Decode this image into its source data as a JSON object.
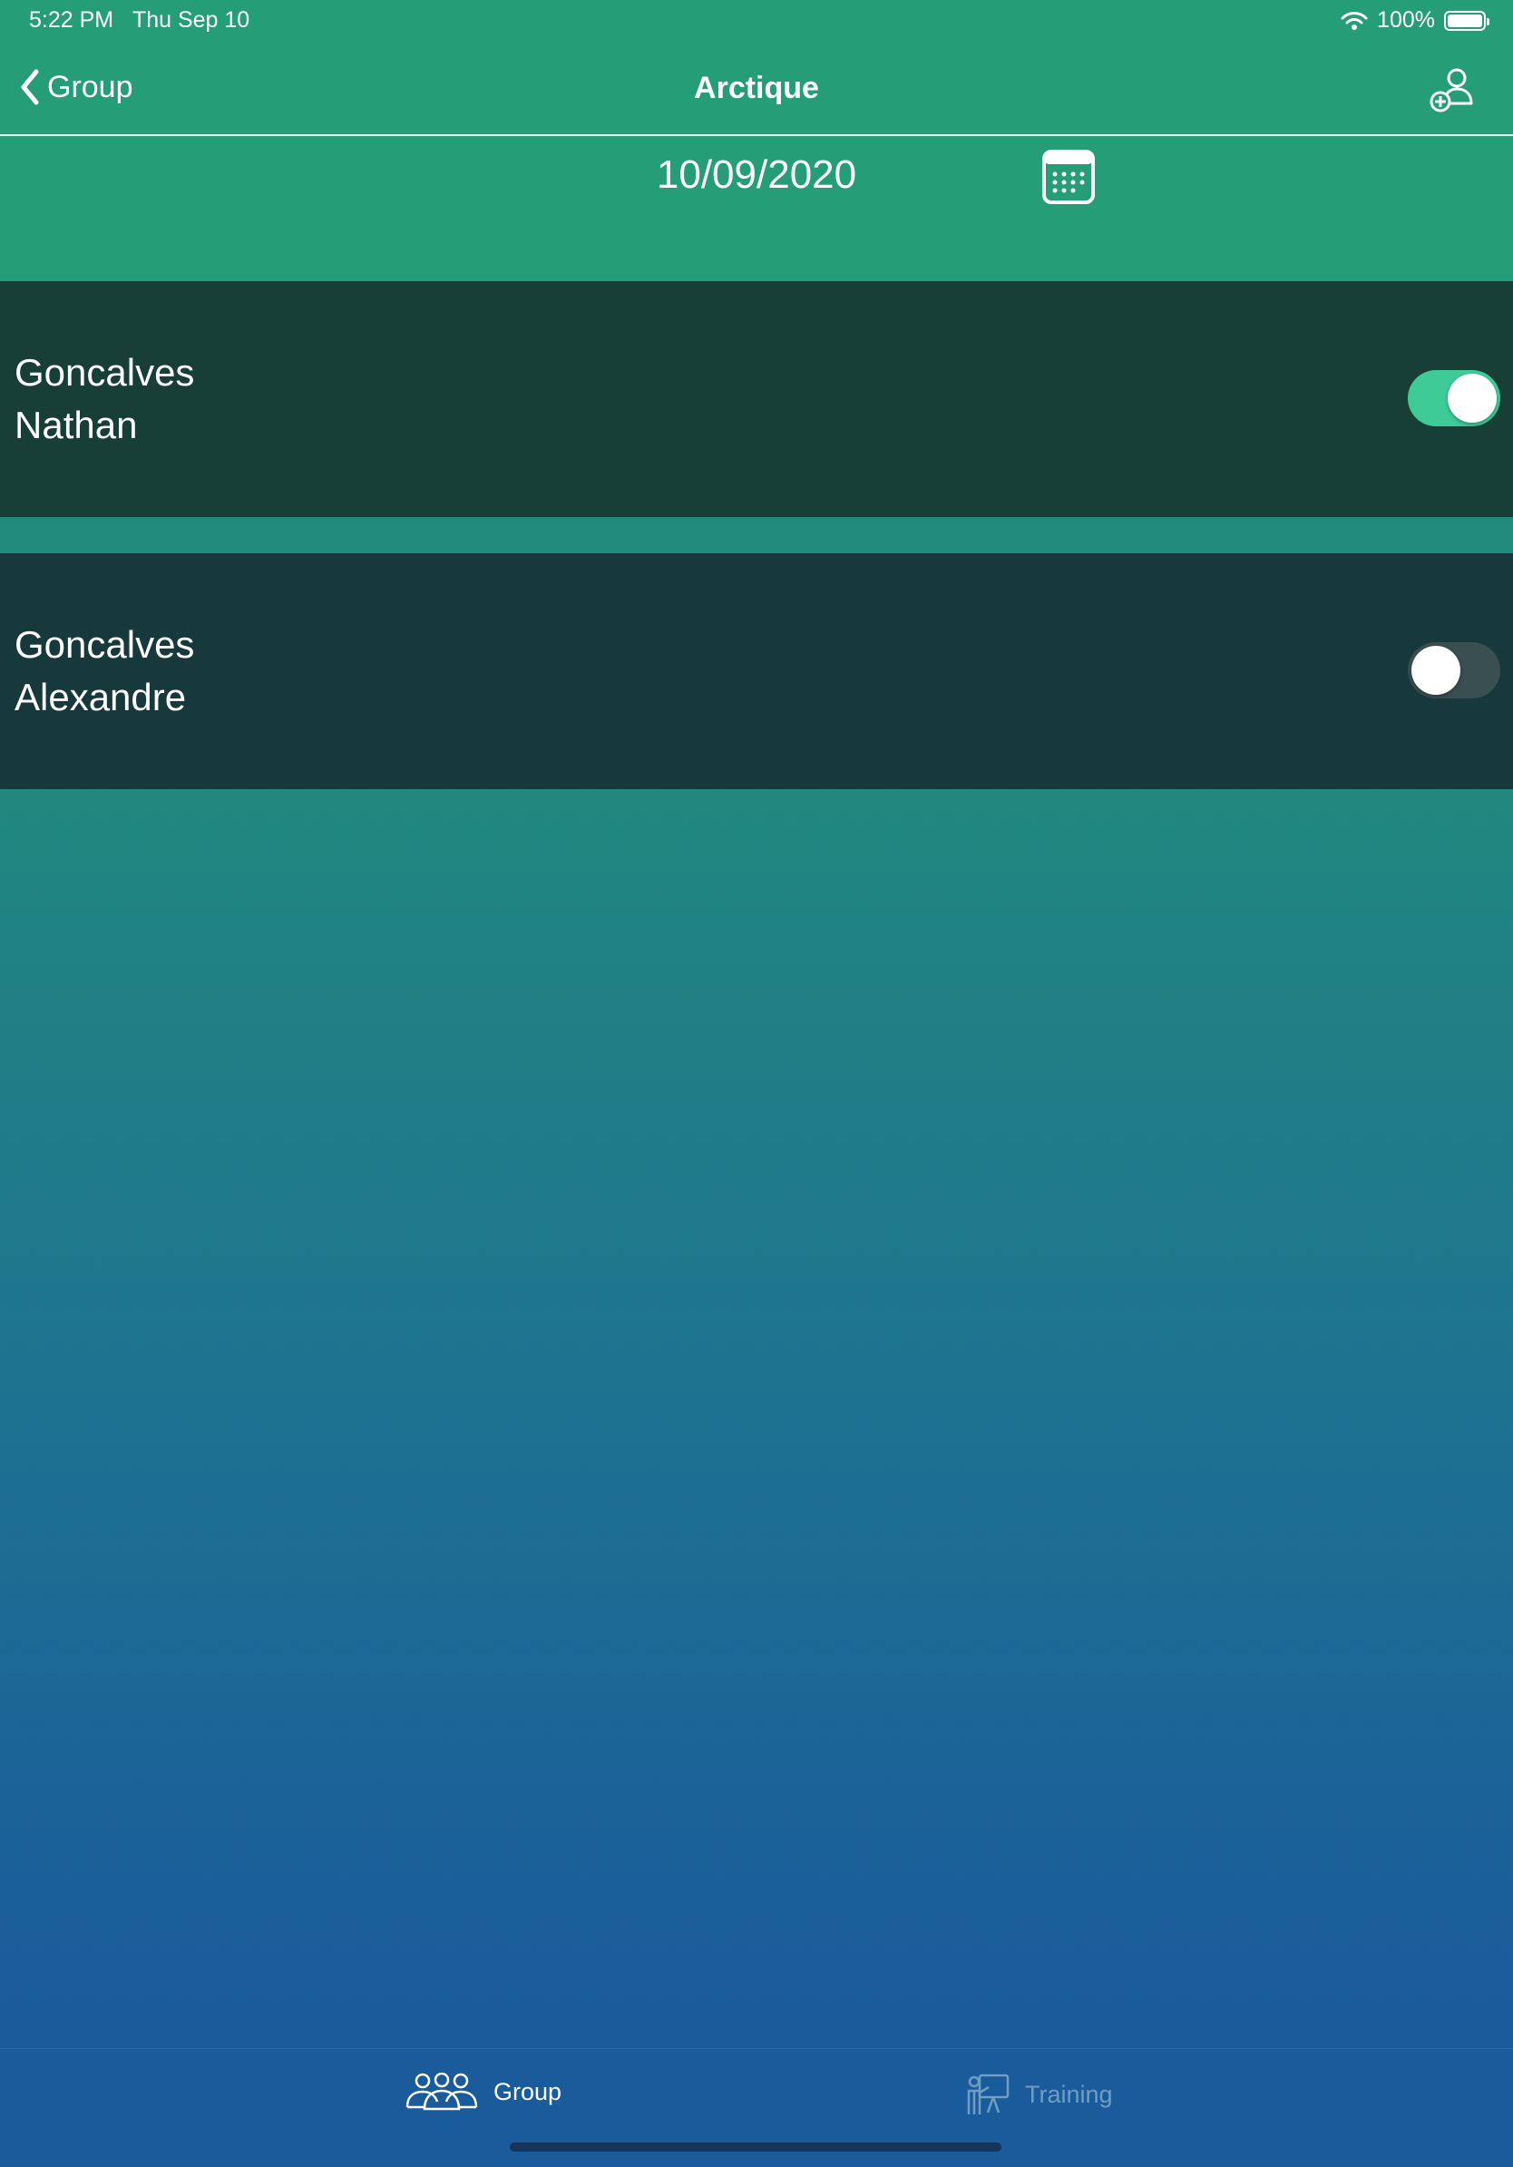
{
  "status_bar": {
    "time": "5:22 PM",
    "date": "Thu Sep 10",
    "battery": "100%"
  },
  "nav": {
    "back_label": "Group",
    "title": "Arctique"
  },
  "date_picker": {
    "date": "10/09/2020"
  },
  "members": [
    {
      "last_name": "Goncalves",
      "first_name": "Nathan",
      "present": true
    },
    {
      "last_name": "Goncalves",
      "first_name": "Alexandre",
      "present": false
    }
  ],
  "tab_bar": {
    "group_label": "Group",
    "training_label": "Training"
  },
  "colors": {
    "header_green": "#259e78",
    "toggle_on": "#3ecb98",
    "row_dark": "#173f36",
    "tab_blue": "#1a5b9b"
  }
}
